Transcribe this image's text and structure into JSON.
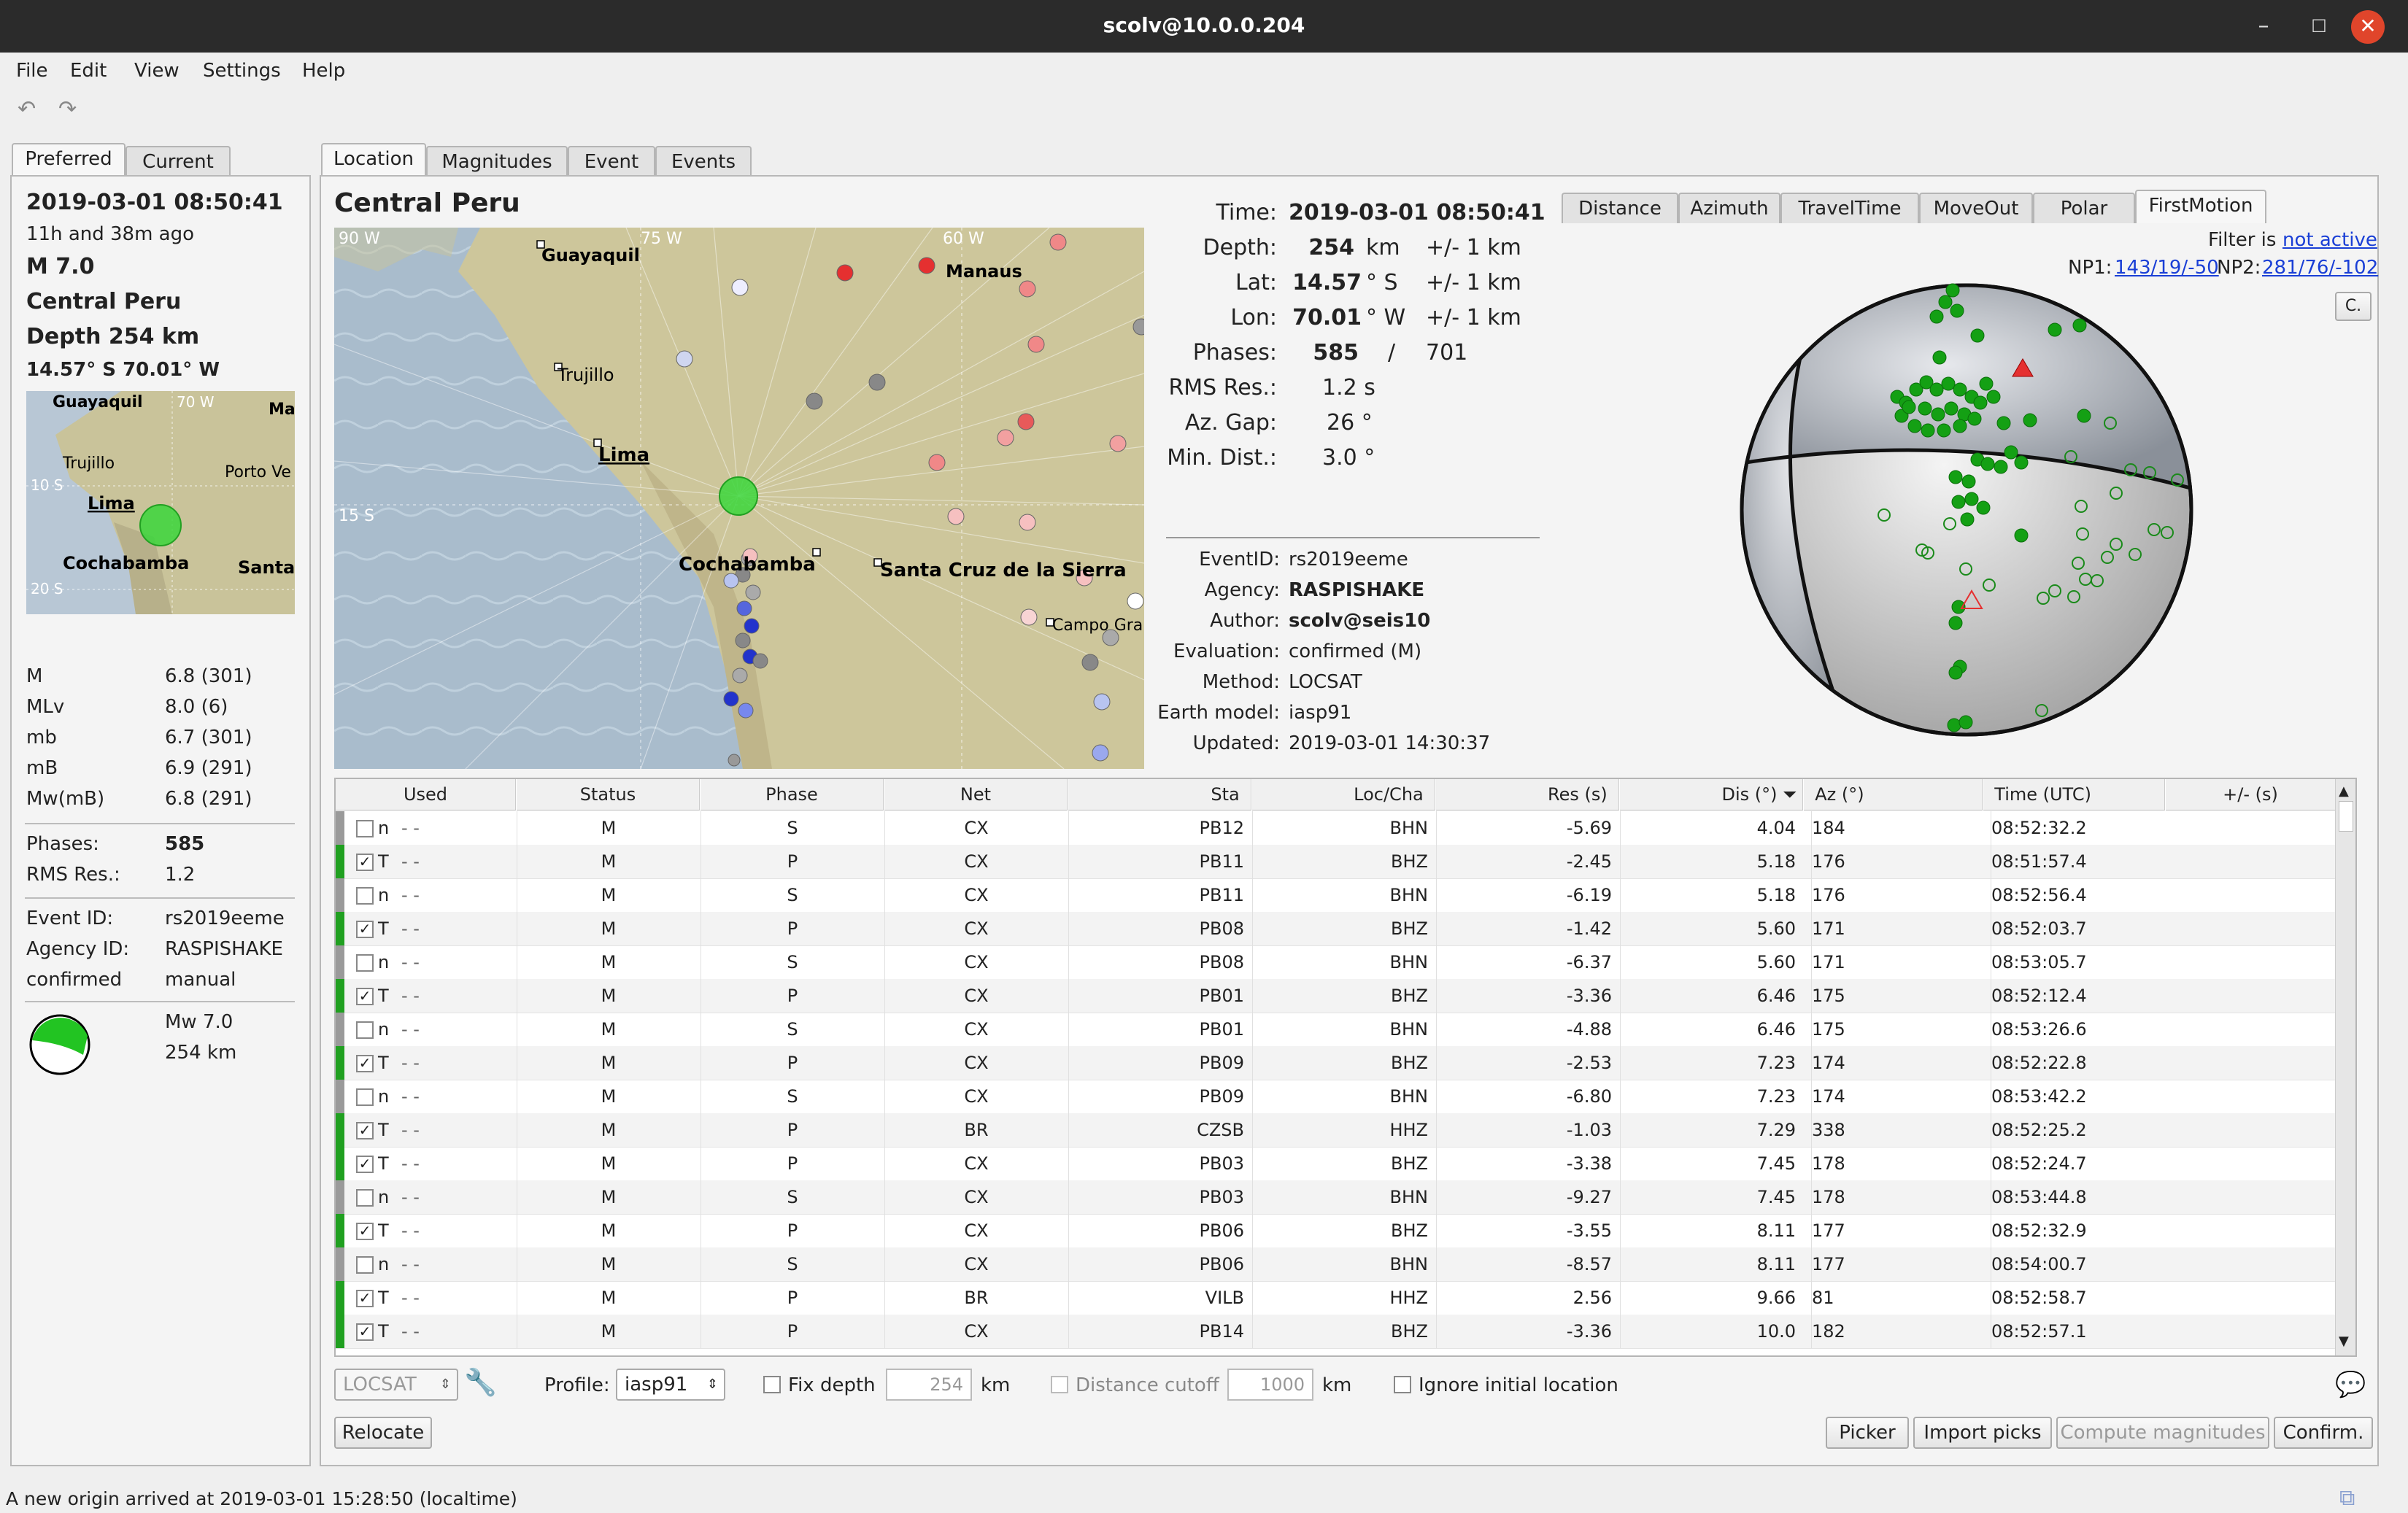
{
  "window": {
    "title": "scolv@10.0.0.204",
    "controls": [
      "minimize-icon",
      "maximize-icon",
      "close-icon"
    ]
  },
  "menu": [
    "File",
    "Edit",
    "View",
    "Settings",
    "Help"
  ],
  "left_tabs": [
    "Preferred",
    "Current"
  ],
  "main_tabs": [
    "Location",
    "Magnitudes",
    "Event",
    "Events"
  ],
  "summary": {
    "time": "2019-03-01 08:50:41",
    "ago": "11h and 38m ago",
    "magnitude": "M 7.0",
    "region": "Central Peru",
    "depth": "Depth 254 km",
    "coords": "14.57° S  70.01° W",
    "map_labels": [
      "Guayaquil",
      "Ma",
      "Trujillo",
      "Porto Ve",
      "Lima",
      "Cochabamba",
      "Santa"
    ],
    "grid_labels": [
      "70 W",
      "10 S",
      "20 S"
    ],
    "mags": [
      {
        "type": "M",
        "value": "6.8 (301)"
      },
      {
        "type": "MLv",
        "value": "8.0 (6)"
      },
      {
        "type": "mb",
        "value": "6.7 (301)"
      },
      {
        "type": "mB",
        "value": "6.9 (291)"
      },
      {
        "type": "Mw(mB)",
        "value": "6.8 (291)"
      }
    ],
    "phases_label": "Phases:",
    "phases": "585",
    "rms_label": "RMS Res.:",
    "rms": "1.2",
    "event_id_label": "Event ID:",
    "event_id": "rs2019eeme",
    "agency_label": "Agency ID:",
    "agency": "RASPISHAKE",
    "status": "confirmed",
    "mode": "manual",
    "fm_mag": "Mw 7.0",
    "fm_depth": "254 km"
  },
  "location": {
    "region": "Central Peru",
    "map_labels": [
      "Guayaquil",
      "Manaus",
      "Trujillo",
      "Lima",
      "Cochabamba",
      "Santa Cruz de la Sierra",
      "Campo Gra"
    ],
    "grid_labels": [
      "90 W",
      "75 W",
      "60 W",
      "15 S"
    ],
    "details": {
      "time_label": "Time:",
      "time": "2019-03-01 08:50:41",
      "depth_label": "Depth:",
      "depth": "254",
      "depth_unit": "km",
      "depth_err": "+/- 1 km",
      "lat_label": "Lat:",
      "lat": "14.57",
      "lat_unit": "° S",
      "lat_err": "+/- 1 km",
      "lon_label": "Lon:",
      "lon": "70.01",
      "lon_unit": "° W",
      "lon_err": "+/- 1 km",
      "phases_label": "Phases:",
      "phases": "585",
      "phases_sep": "/",
      "phases_total": "701",
      "rms_label": "RMS Res.:",
      "rms": "1.2 s",
      "gap_label": "Az. Gap:",
      "gap": "26 °",
      "mindist_label": "Min. Dist.:",
      "mindist": "3.0 °"
    },
    "event": [
      {
        "label": "EventID:",
        "value": "rs2019eeme",
        "bold": false
      },
      {
        "label": "Agency:",
        "value": "RASPISHAKE",
        "bold": true
      },
      {
        "label": "Author:",
        "value": "scolv@seis10",
        "bold": true
      },
      {
        "label": "Evaluation:",
        "value": "confirmed (M)",
        "bold": false
      },
      {
        "label": "Method:",
        "value": "LOCSAT",
        "bold": false
      },
      {
        "label": "Earth model:",
        "value": "iasp91",
        "bold": false
      },
      {
        "label": "Updated:",
        "value": "2019-03-01 14:30:37",
        "bold": false
      }
    ]
  },
  "plot_tabs": [
    "Distance",
    "Azimuth",
    "TravelTime",
    "MoveOut",
    "Polar",
    "FirstMotion"
  ],
  "firstmotion": {
    "filter_label": "Filter is",
    "filter_value": "not active",
    "np1_label": "NP1:",
    "np1": "143/19/-50",
    "np2_label": "NP2:",
    "np2": "281/76/-102",
    "corner_button": "C."
  },
  "table": {
    "columns": [
      "Used",
      "Status",
      "Phase",
      "Net",
      "Sta",
      "Loc/Cha",
      "Res (s)",
      "Dis (°)",
      "Az (°)",
      "Time (UTC)",
      "+/- (s)"
    ],
    "rows": [
      {
        "used": false,
        "flag": "n",
        "status": "M",
        "phase": "S",
        "net": "CX",
        "sta": "PB12",
        "cha": "BHN",
        "res": "-5.69",
        "dis": "4.04",
        "az": "184",
        "time": "08:52:32.2"
      },
      {
        "used": true,
        "flag": "T",
        "status": "M",
        "phase": "P",
        "net": "CX",
        "sta": "PB11",
        "cha": "BHZ",
        "res": "-2.45",
        "dis": "5.18",
        "az": "176",
        "time": "08:51:57.4"
      },
      {
        "used": false,
        "flag": "n",
        "status": "M",
        "phase": "S",
        "net": "CX",
        "sta": "PB11",
        "cha": "BHN",
        "res": "-6.19",
        "dis": "5.18",
        "az": "176",
        "time": "08:52:56.4"
      },
      {
        "used": true,
        "flag": "T",
        "status": "M",
        "phase": "P",
        "net": "CX",
        "sta": "PB08",
        "cha": "BHZ",
        "res": "-1.42",
        "dis": "5.60",
        "az": "171",
        "time": "08:52:03.7"
      },
      {
        "used": false,
        "flag": "n",
        "status": "M",
        "phase": "S",
        "net": "CX",
        "sta": "PB08",
        "cha": "BHN",
        "res": "-6.37",
        "dis": "5.60",
        "az": "171",
        "time": "08:53:05.7"
      },
      {
        "used": true,
        "flag": "T",
        "status": "M",
        "phase": "P",
        "net": "CX",
        "sta": "PB01",
        "cha": "BHZ",
        "res": "-3.36",
        "dis": "6.46",
        "az": "175",
        "time": "08:52:12.4"
      },
      {
        "used": false,
        "flag": "n",
        "status": "M",
        "phase": "S",
        "net": "CX",
        "sta": "PB01",
        "cha": "BHN",
        "res": "-4.88",
        "dis": "6.46",
        "az": "175",
        "time": "08:53:26.6"
      },
      {
        "used": true,
        "flag": "T",
        "status": "M",
        "phase": "P",
        "net": "CX",
        "sta": "PB09",
        "cha": "BHZ",
        "res": "-2.53",
        "dis": "7.23",
        "az": "174",
        "time": "08:52:22.8"
      },
      {
        "used": false,
        "flag": "n",
        "status": "M",
        "phase": "S",
        "net": "CX",
        "sta": "PB09",
        "cha": "BHN",
        "res": "-6.80",
        "dis": "7.23",
        "az": "174",
        "time": "08:53:42.2"
      },
      {
        "used": true,
        "flag": "T",
        "status": "M",
        "phase": "P",
        "net": "BR",
        "sta": "CZSB",
        "cha": "HHZ",
        "res": "-1.03",
        "dis": "7.29",
        "az": "338",
        "time": "08:52:25.2"
      },
      {
        "used": true,
        "flag": "T",
        "status": "M",
        "phase": "P",
        "net": "CX",
        "sta": "PB03",
        "cha": "BHZ",
        "res": "-3.38",
        "dis": "7.45",
        "az": "178",
        "time": "08:52:24.7"
      },
      {
        "used": false,
        "flag": "n",
        "status": "M",
        "phase": "S",
        "net": "CX",
        "sta": "PB03",
        "cha": "BHN",
        "res": "-9.27",
        "dis": "7.45",
        "az": "178",
        "time": "08:53:44.8"
      },
      {
        "used": true,
        "flag": "T",
        "status": "M",
        "phase": "P",
        "net": "CX",
        "sta": "PB06",
        "cha": "BHZ",
        "res": "-3.55",
        "dis": "8.11",
        "az": "177",
        "time": "08:52:32.9"
      },
      {
        "used": false,
        "flag": "n",
        "status": "M",
        "phase": "S",
        "net": "CX",
        "sta": "PB06",
        "cha": "BHN",
        "res": "-8.57",
        "dis": "8.11",
        "az": "177",
        "time": "08:54:00.7"
      },
      {
        "used": true,
        "flag": "T",
        "status": "M",
        "phase": "P",
        "net": "BR",
        "sta": "VILB",
        "cha": "HHZ",
        "res": "2.56",
        "dis": "9.66",
        "az": "81",
        "time": "08:52:58.7"
      },
      {
        "used": true,
        "flag": "T",
        "status": "M",
        "phase": "P",
        "net": "CX",
        "sta": "PB14",
        "cha": "BHZ",
        "res": "-3.36",
        "dis": "10.0",
        "az": "182",
        "time": "08:52:57.1"
      }
    ]
  },
  "controls": {
    "method": "LOCSAT",
    "profile_label": "Profile:",
    "profile": "iasp91",
    "fix_depth_label": "Fix depth",
    "fix_depth_value": "254",
    "km": "km",
    "distance_cutoff_label": "Distance cutoff",
    "distance_cutoff_value": "1000",
    "ignore_label": "Ignore initial location",
    "relocate": "Relocate",
    "picker": "Picker",
    "import_picks": "Import picks",
    "compute_magnitudes": "Compute magnitudes",
    "confirm": "Confirm."
  },
  "status_bar": "A new origin arrived at 2019-03-01 15:28:50 (localtime)",
  "colors": {
    "used": "#20a020",
    "accent": "#1a3fd6",
    "titlebar": "#2b2b2b",
    "close": "#e0452b"
  }
}
